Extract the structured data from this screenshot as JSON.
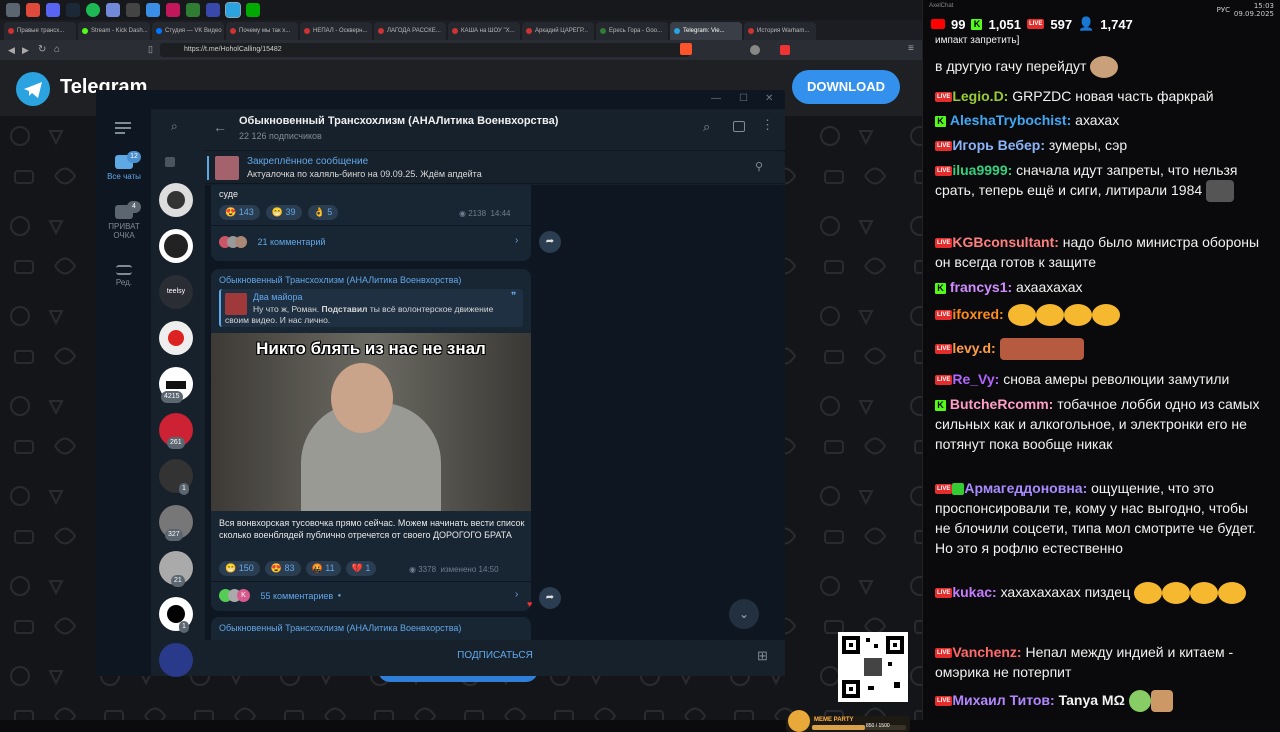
{
  "taskbar": {
    "clock": "15:03",
    "date": "09.09.2025",
    "lang": "РУС"
  },
  "browser": {
    "tabs": [
      {
        "label": "Правые трансх..."
      },
      {
        "label": "Stream - Kick Dash..."
      },
      {
        "label": "Студия — VK Видео"
      },
      {
        "label": "Почему мы так х..."
      },
      {
        "label": "НЕПАЛ - Оскверн..."
      },
      {
        "label": "ЛАГОДА РАССКЕ..."
      },
      {
        "label": "КАША на ШОУ \"Х..."
      },
      {
        "label": "Аркадий ЦАРЕГР..."
      },
      {
        "label": "Ересь Гора - Goo..."
      },
      {
        "label": "Telegram: Vie..."
      },
      {
        "label": "История Warham..."
      }
    ],
    "url": "https://t.me/HoholCalling/15482"
  },
  "page": {
    "logo_text": "Telegram",
    "download_label": "DOWNLOAD"
  },
  "telegram": {
    "folders": [
      {
        "label": "Все чаты",
        "badge": "12"
      },
      {
        "label": "ПРИВАТ ОЧКА",
        "badge": "4"
      },
      {
        "label": "Ред.",
        "badge": ""
      }
    ],
    "chat_badges": [
      "4215",
      "261",
      "1",
      "327",
      "21",
      "1"
    ],
    "chat_avatar_text": "teelsy",
    "channel_title": "Обыкновенный Трансхохлизм (АНАЛитика Военвхорства)",
    "subscribers": "22 126 подписчиков",
    "pinned": {
      "label": "Закреплённое сообщение",
      "text": "Актуалочка по халяль-бинго на 09.09.25. Ждём апдейта"
    },
    "msg1": {
      "tail_text": "суде",
      "reactions": [
        {
          "emoji": "😍",
          "count": "143"
        },
        {
          "emoji": "😁",
          "count": "39"
        },
        {
          "emoji": "👌",
          "count": "5"
        }
      ],
      "views": "2138",
      "time": "14:44",
      "comments": "21 комментарий"
    },
    "msg2": {
      "author": "Обыкновенный Трансхохлизм (АНАЛитика Военвхорства)",
      "reply_author": "Два майора",
      "reply_text_a": "Ну что ж, Роман. ",
      "reply_text_b": "Подставил",
      "reply_text_c": " ты всё волонтерское движение своим видео. И нас лично.",
      "image_caption": "Никто блять из нас не знал",
      "text": "Вся вонвхорская тусовочка прямо сейчас. Можем начинать вести список сколько военблядей публично отречется от своего ДОРОГОГО БРАТА",
      "reactions": [
        {
          "emoji": "😁",
          "count": "150"
        },
        {
          "emoji": "😍",
          "count": "83"
        },
        {
          "emoji": "🤬",
          "count": "11"
        },
        {
          "emoji": "💔",
          "count": "1"
        }
      ],
      "views": "3378",
      "edited": "изменено 14:50",
      "comments": "55 комментариев",
      "avatar_letter": "K"
    },
    "msg3": {
      "author": "Обыкновенный Трансхохлизм (АНАЛитика Военвхорства)"
    },
    "subscribe_label": "ПОДПИСАТЬСЯ"
  },
  "stream": {
    "stats": {
      "youtube": "99",
      "kick": "1,051",
      "live": "597",
      "viewers": "1,747"
    },
    "topbar_user": "AxelChat",
    "messages": [
      {
        "user": "",
        "text": "импакт запретить]",
        "platform": "none",
        "color": "#ffffff"
      },
      {
        "user": "",
        "text": "в другую гачу перейдут",
        "platform": "none",
        "color": "#ffffff"
      },
      {
        "user": "Legio.D:",
        "text": "GRPZDC новая часть фаркрай",
        "platform": "live",
        "color": "#9acd32"
      },
      {
        "user": "AleshaTrybochist:",
        "text": "ахахах",
        "platform": "kick",
        "color": "#3fa9f5"
      },
      {
        "user": "Игорь Вебер:",
        "text": "зумеры, сэр",
        "platform": "live",
        "color": "#8ab4f8"
      },
      {
        "user": "ilua9999:",
        "text": "сначала идут запреты, что нельзя срать, теперь ещё и сиги, литирали 1984",
        "platform": "live",
        "color": "#35d07f"
      },
      {
        "user": "KGBconsultant:",
        "text": "надо было министра обороны он всегда готов к защите",
        "platform": "live",
        "color": "#ff7f7f"
      },
      {
        "user": "francys1:",
        "text": "ахаахахах",
        "platform": "kick",
        "color": "#d08cff"
      },
      {
        "user": "ifoxred:",
        "text": "",
        "platform": "live",
        "color": "#ff8c1a"
      },
      {
        "user": "levy.d:",
        "text": "",
        "platform": "live",
        "color": "#ff9f43"
      },
      {
        "user": "Re_Vy:",
        "text": "снова амеры революции замутили",
        "platform": "live",
        "color": "#b266ff"
      },
      {
        "user": "ButcheRcomm:",
        "text": "тобачное лобби одно из самых сильных как и алкогольное, и электронки его не потянут пока вообще никак",
        "platform": "kick",
        "color": "#ff9ec4"
      },
      {
        "user": "Армагеддоновна:",
        "text": "ощущение, что это проспонсировали те, кому у нас выгодно, чтобы не блочили соцсети, типа мол смотрите че будет. Но это я рофлю естественно",
        "platform": "live",
        "color": "#a98bff"
      },
      {
        "user": "kukac:",
        "text": "хахахахахах пиздец",
        "platform": "live",
        "color": "#c77dff"
      },
      {
        "user": "Vanchenz:",
        "text": "Непал между индией и китаем - омэрика не потерпит",
        "platform": "live",
        "color": "#ff6b6b"
      },
      {
        "user": "Михаил Титов:",
        "text": "Tanya MΩ",
        "platform": "live",
        "color": "#b388ff"
      }
    ],
    "meme_party": "MEME PARTY",
    "meme_progress": "850 / 1500"
  }
}
